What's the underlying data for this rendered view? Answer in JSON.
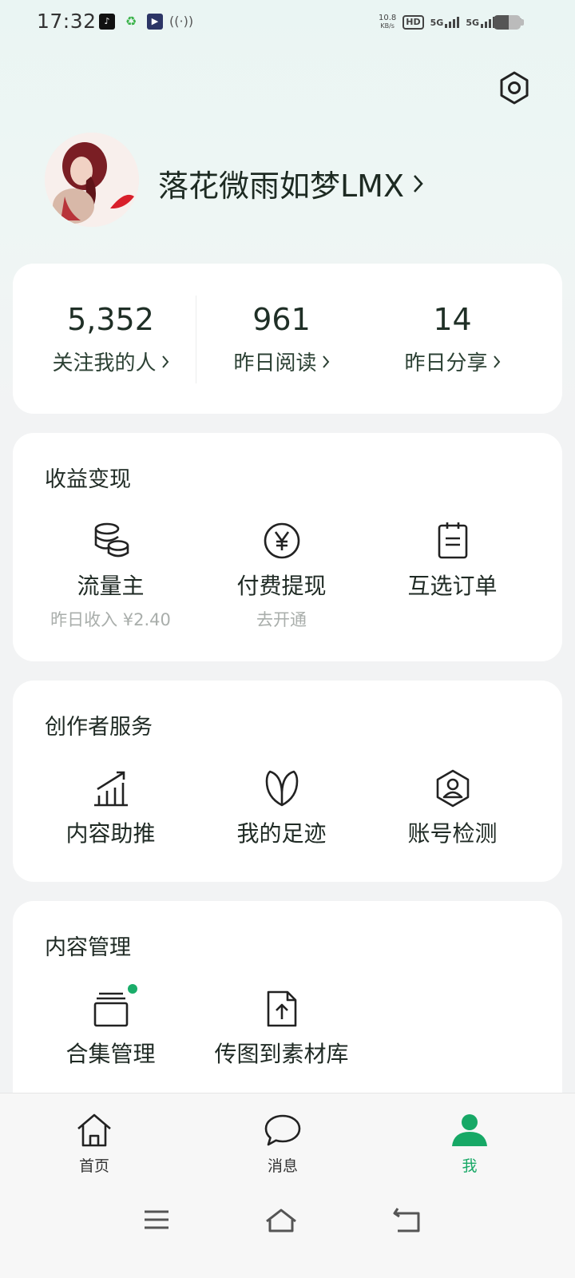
{
  "status_bar": {
    "time": "17:32",
    "net_speed_value": "10.8",
    "net_speed_unit": "KB/s",
    "hd_label": "HD",
    "sim1_label": "5G",
    "sim2_label": "5G",
    "battery_level": 0.55
  },
  "profile": {
    "name": "落花微雨如梦LMX",
    "chevron": "›"
  },
  "stats": [
    {
      "value": "5,352",
      "label": "关注我的人"
    },
    {
      "value": "961",
      "label": "昨日阅读"
    },
    {
      "value": "14",
      "label": "昨日分享"
    }
  ],
  "earnings": {
    "title": "收益变现",
    "items": [
      {
        "label": "流量主",
        "sub": "昨日收入 ¥2.40",
        "icon": "coins-icon"
      },
      {
        "label": "付费提现",
        "sub": "去开通",
        "icon": "yen-circle-icon"
      },
      {
        "label": "互选订单",
        "sub": "",
        "icon": "clipboard-icon"
      }
    ]
  },
  "creator_services": {
    "title": "创作者服务",
    "items": [
      {
        "label": "内容助推",
        "icon": "growth-chart-icon"
      },
      {
        "label": "我的足迹",
        "icon": "leaf-icon"
      },
      {
        "label": "账号检测",
        "icon": "user-shield-icon"
      }
    ]
  },
  "content_management": {
    "title": "内容管理",
    "items": [
      {
        "label": "合集管理",
        "icon": "collection-icon",
        "has_dot": true
      },
      {
        "label": "传图到素材库",
        "icon": "file-upload-icon",
        "has_dot": false
      }
    ]
  },
  "bottom_nav": {
    "items": [
      {
        "label": "首页",
        "icon": "home-icon",
        "active": false
      },
      {
        "label": "消息",
        "icon": "message-icon",
        "active": false
      },
      {
        "label": "我",
        "icon": "person-icon",
        "active": true
      }
    ]
  },
  "colors": {
    "accent": "#17a866",
    "text_primary": "#1d2a22",
    "text_muted": "#a9aeab",
    "card_bg": "#ffffff"
  }
}
